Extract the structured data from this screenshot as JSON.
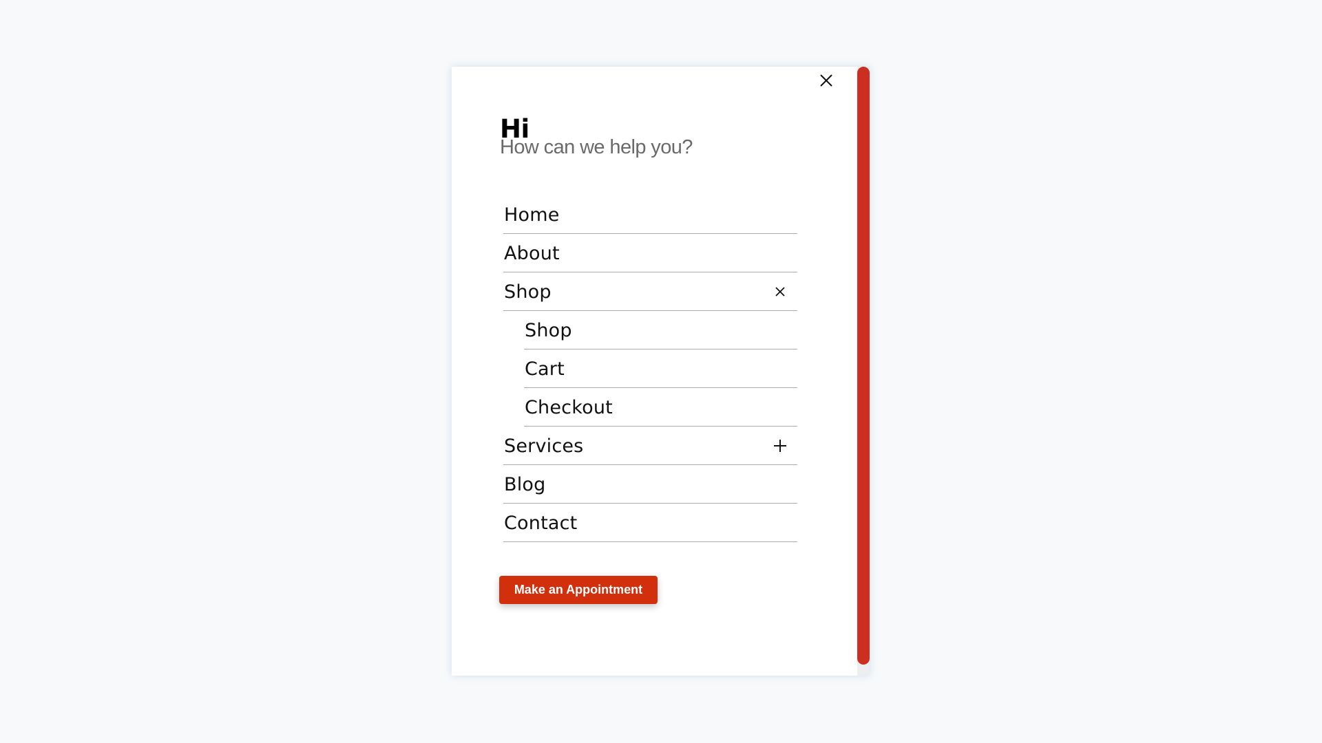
{
  "panel": {
    "close_icon": "close-icon",
    "greeting": {
      "title": "Hi",
      "subtitle": "How can we help you?"
    },
    "menu": [
      {
        "label": "Home",
        "level": 0,
        "toggle": null
      },
      {
        "label": "About",
        "level": 0,
        "toggle": null
      },
      {
        "label": "Shop",
        "level": 0,
        "toggle": "close-icon",
        "expanded": true
      },
      {
        "label": "Shop",
        "level": 1,
        "toggle": null
      },
      {
        "label": "Cart",
        "level": 1,
        "toggle": null
      },
      {
        "label": "Checkout",
        "level": 1,
        "toggle": null
      },
      {
        "label": "Services",
        "level": 0,
        "toggle": "plus-icon",
        "expanded": false
      },
      {
        "label": "Blog",
        "level": 0,
        "toggle": null
      },
      {
        "label": "Contact",
        "level": 0,
        "toggle": null
      }
    ],
    "cta_label": "Make an Appointment"
  },
  "colors": {
    "accent": "#d2300c",
    "scrollbar_thumb": "#cc2e1f",
    "background": "#f7f9fa",
    "divider": "#ababab",
    "subtitle_text": "#6a6a6a"
  }
}
